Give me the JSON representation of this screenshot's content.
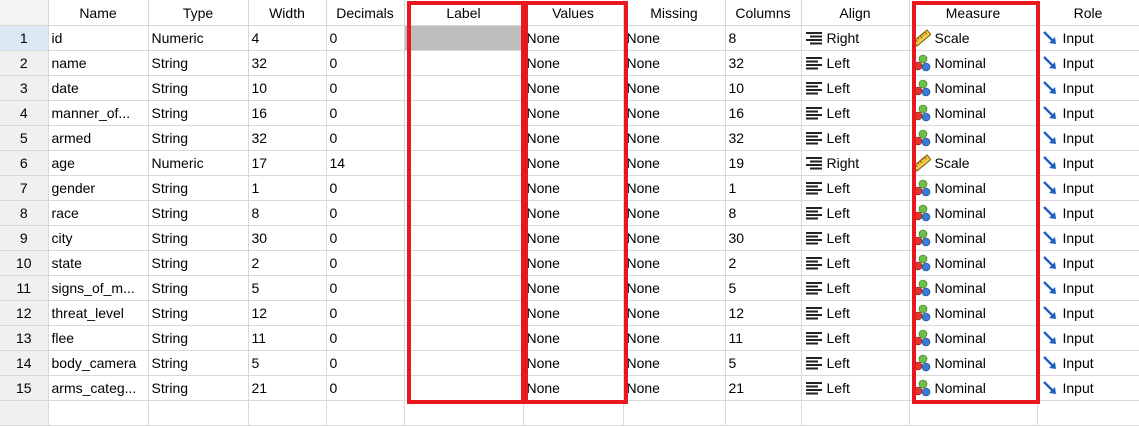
{
  "columns": [
    {
      "label": "Name"
    },
    {
      "label": "Type"
    },
    {
      "label": "Width"
    },
    {
      "label": "Decimals"
    },
    {
      "label": "Label"
    },
    {
      "label": "Values"
    },
    {
      "label": "Missing"
    },
    {
      "label": "Columns"
    },
    {
      "label": "Align"
    },
    {
      "label": "Measure"
    },
    {
      "label": "Role"
    }
  ],
  "icons": {
    "align-right": "align-right-icon",
    "align-left": "align-left-icon",
    "scale": "ruler-scale-icon",
    "nominal": "nominal-balls-icon",
    "input": "input-arrow-icon"
  },
  "highlight_color": "#e8181e",
  "rows": [
    {
      "num": "1",
      "name": "id",
      "type": "Numeric",
      "width": "4",
      "decimals": "0",
      "label": "",
      "values": "None",
      "missing": "None",
      "columns": "8",
      "align": "Right",
      "measure": "Scale",
      "role": "Input"
    },
    {
      "num": "2",
      "name": "name",
      "type": "String",
      "width": "32",
      "decimals": "0",
      "label": "",
      "values": "None",
      "missing": "None",
      "columns": "32",
      "align": "Left",
      "measure": "Nominal",
      "role": "Input"
    },
    {
      "num": "3",
      "name": "date",
      "type": "String",
      "width": "10",
      "decimals": "0",
      "label": "",
      "values": "None",
      "missing": "None",
      "columns": "10",
      "align": "Left",
      "measure": "Nominal",
      "role": "Input"
    },
    {
      "num": "4",
      "name": "manner_of...",
      "type": "String",
      "width": "16",
      "decimals": "0",
      "label": "",
      "values": "None",
      "missing": "None",
      "columns": "16",
      "align": "Left",
      "measure": "Nominal",
      "role": "Input"
    },
    {
      "num": "5",
      "name": "armed",
      "type": "String",
      "width": "32",
      "decimals": "0",
      "label": "",
      "values": "None",
      "missing": "None",
      "columns": "32",
      "align": "Left",
      "measure": "Nominal",
      "role": "Input"
    },
    {
      "num": "6",
      "name": "age",
      "type": "Numeric",
      "width": "17",
      "decimals": "14",
      "label": "",
      "values": "None",
      "missing": "None",
      "columns": "19",
      "align": "Right",
      "measure": "Scale",
      "role": "Input"
    },
    {
      "num": "7",
      "name": "gender",
      "type": "String",
      "width": "1",
      "decimals": "0",
      "label": "",
      "values": "None",
      "missing": "None",
      "columns": "1",
      "align": "Left",
      "measure": "Nominal",
      "role": "Input"
    },
    {
      "num": "8",
      "name": "race",
      "type": "String",
      "width": "8",
      "decimals": "0",
      "label": "",
      "values": "None",
      "missing": "None",
      "columns": "8",
      "align": "Left",
      "measure": "Nominal",
      "role": "Input"
    },
    {
      "num": "9",
      "name": "city",
      "type": "String",
      "width": "30",
      "decimals": "0",
      "label": "",
      "values": "None",
      "missing": "None",
      "columns": "30",
      "align": "Left",
      "measure": "Nominal",
      "role": "Input"
    },
    {
      "num": "10",
      "name": "state",
      "type": "String",
      "width": "2",
      "decimals": "0",
      "label": "",
      "values": "None",
      "missing": "None",
      "columns": "2",
      "align": "Left",
      "measure": "Nominal",
      "role": "Input"
    },
    {
      "num": "11",
      "name": "signs_of_m...",
      "type": "String",
      "width": "5",
      "decimals": "0",
      "label": "",
      "values": "None",
      "missing": "None",
      "columns": "5",
      "align": "Left",
      "measure": "Nominal",
      "role": "Input"
    },
    {
      "num": "12",
      "name": "threat_level",
      "type": "String",
      "width": "12",
      "decimals": "0",
      "label": "",
      "values": "None",
      "missing": "None",
      "columns": "12",
      "align": "Left",
      "measure": "Nominal",
      "role": "Input"
    },
    {
      "num": "13",
      "name": "flee",
      "type": "String",
      "width": "11",
      "decimals": "0",
      "label": "",
      "values": "None",
      "missing": "None",
      "columns": "11",
      "align": "Left",
      "measure": "Nominal",
      "role": "Input"
    },
    {
      "num": "14",
      "name": "body_camera",
      "type": "String",
      "width": "5",
      "decimals": "0",
      "label": "",
      "values": "None",
      "missing": "None",
      "columns": "5",
      "align": "Left",
      "measure": "Nominal",
      "role": "Input"
    },
    {
      "num": "15",
      "name": "arms_categ...",
      "type": "String",
      "width": "21",
      "decimals": "0",
      "label": "",
      "values": "None",
      "missing": "None",
      "columns": "21",
      "align": "Left",
      "measure": "Nominal",
      "role": "Input"
    }
  ]
}
